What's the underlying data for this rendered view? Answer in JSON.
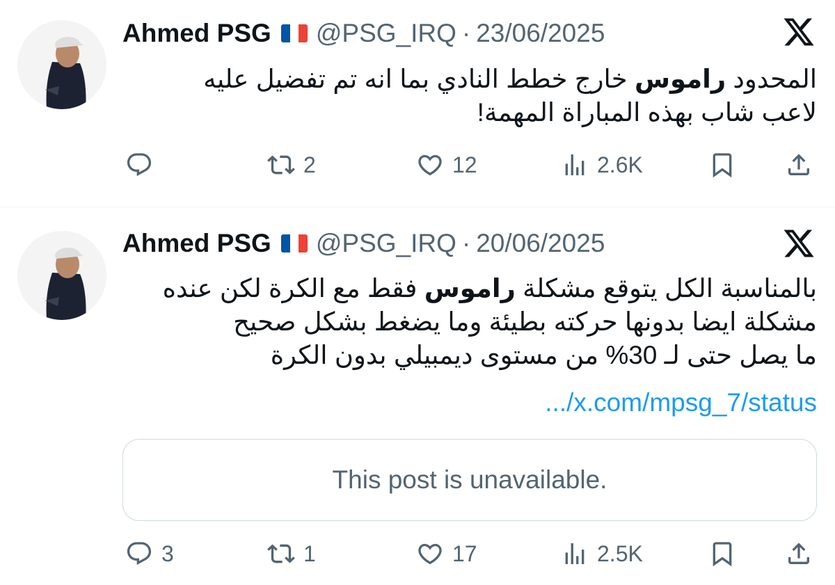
{
  "tweets": [
    {
      "author_name": "Ahmed PSG",
      "handle": "@PSG_IRQ",
      "separator": "·",
      "date": "23/06/2025",
      "lines": [
        {
          "pre": "المحدود ",
          "bold": "راموس",
          "post": " خارج خطط النادي بما انه تم تفضيل عليه"
        },
        {
          "pre": "لاعب شاب بهذه المباراة المهمة!",
          "bold": "",
          "post": ""
        }
      ],
      "replies": "",
      "reposts": "2",
      "likes": "12",
      "views": "2.6K"
    },
    {
      "author_name": "Ahmed PSG",
      "handle": "@PSG_IRQ",
      "separator": "·",
      "date": "20/06/2025",
      "lines": [
        {
          "pre": "بالمناسبة الكل يتوقع مشكلة ",
          "bold": "راموس",
          "post": " فقط مع الكرة لكن عنده"
        },
        {
          "pre": "مشكلة ايضا بدونها حركته بطيئة وما يضغط بشكل صحيح",
          "bold": "",
          "post": ""
        },
        {
          "pre": "ما يصل حتى لـ 30% من مستوى ديمبيلي بدون الكرة",
          "bold": "",
          "post": ""
        }
      ],
      "link": ".../x.com/mpsg_7/status",
      "quoted_unavailable": "This post is unavailable.",
      "replies": "3",
      "reposts": "1",
      "likes": "17",
      "views": "2.5K"
    }
  ],
  "icons": {
    "reply": "speech-bubble-icon",
    "repost": "repost-arrows-icon",
    "like": "heart-icon",
    "views": "bar-chart-icon",
    "bookmark": "bookmark-icon",
    "share": "share-upload-icon",
    "platform": "x-logo-icon"
  },
  "colors": {
    "text": "#0f1419",
    "secondary": "#536471",
    "link": "#1d9bf0",
    "border": "#cfd9de"
  }
}
